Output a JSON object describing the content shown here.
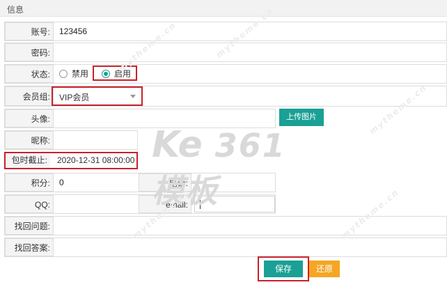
{
  "header": {
    "title": "信息"
  },
  "form": {
    "account": {
      "label": "账号:",
      "value": "123456"
    },
    "password": {
      "label": "密码:"
    },
    "status": {
      "label": "状态:",
      "options": [
        "禁用",
        "启用"
      ],
      "selected": "启用"
    },
    "group": {
      "label": "会员组:",
      "value": "VIP会员"
    },
    "avatar": {
      "label": "头像:",
      "upload_label": "上传图片"
    },
    "nickname": {
      "label": "昵称:"
    },
    "expiry": {
      "label": "包时截止:",
      "value": "2020-12-31 08:00:00"
    },
    "points": {
      "label": "积分:",
      "value": "0"
    },
    "phone": {
      "label": "电话:"
    },
    "qq": {
      "label": "QQ:"
    },
    "email": {
      "label": "email:"
    },
    "question": {
      "label": "找回问题:"
    },
    "answer": {
      "label": "找回答案:"
    }
  },
  "actions": {
    "save_label": "保存",
    "reset_label": "还原"
  },
  "watermark": {
    "main": "361模板",
    "repeat": "mytheme.cn"
  },
  "colors": {
    "accent_green": "#1aa094",
    "accent_orange": "#f5a623",
    "highlight_red": "#c8202b"
  }
}
